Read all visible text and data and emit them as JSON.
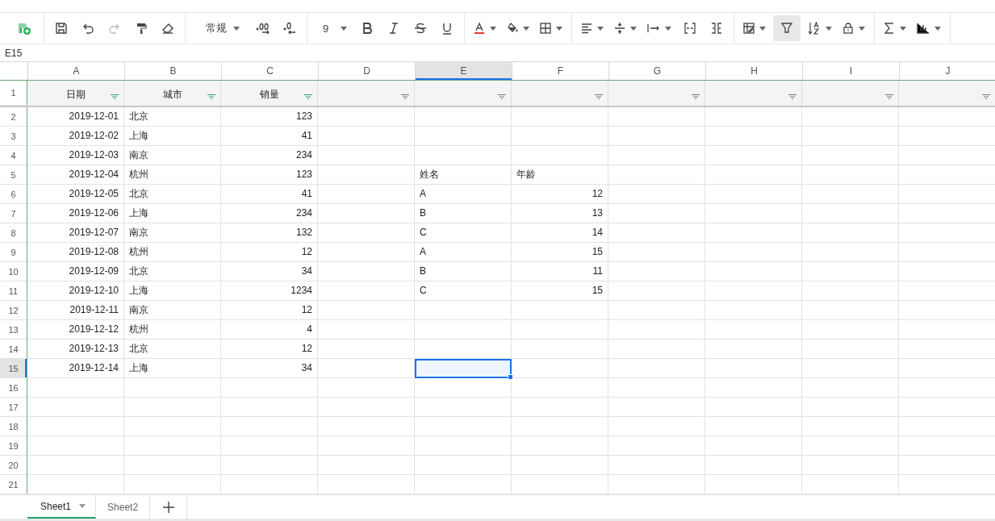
{
  "toolbar": {
    "number_format": "常规",
    "font_size": "9",
    "redo": {
      "disabled": true
    },
    "filter": {
      "selected": true
    }
  },
  "name_box": "E15",
  "columns": [
    {
      "label": "A",
      "selected": false
    },
    {
      "label": "B",
      "selected": false
    },
    {
      "label": "C",
      "selected": false
    },
    {
      "label": "D",
      "selected": false
    },
    {
      "label": "E",
      "selected": true
    },
    {
      "label": "F",
      "selected": false
    },
    {
      "label": "G",
      "selected": false
    },
    {
      "label": "H",
      "selected": false
    },
    {
      "label": "I",
      "selected": false
    },
    {
      "label": "J",
      "selected": false
    }
  ],
  "header_row": {
    "label": "1",
    "cells": [
      {
        "text": "日期",
        "active": true
      },
      {
        "text": "城市",
        "active": true
      },
      {
        "text": "销量",
        "active": true
      },
      {
        "active": false
      },
      {
        "active": false
      },
      {
        "active": false
      },
      {
        "active": false
      },
      {
        "active": false
      },
      {
        "active": false
      },
      {
        "active": false
      }
    ]
  },
  "rows": [
    {
      "label": "2",
      "selected": false,
      "cells": [
        {
          "text": "2019-12-01",
          "kind": "number"
        },
        {
          "text": "北京",
          "kind": "text"
        },
        {
          "text": "123",
          "kind": "number"
        }
      ]
    },
    {
      "label": "3",
      "selected": false,
      "cells": [
        {
          "text": "2019-12-02",
          "kind": "number"
        },
        {
          "text": "上海",
          "kind": "text"
        },
        {
          "text": "41",
          "kind": "number"
        }
      ]
    },
    {
      "label": "4",
      "selected": false,
      "cells": [
        {
          "text": "2019-12-03",
          "kind": "number"
        },
        {
          "text": "南京",
          "kind": "text"
        },
        {
          "text": "234",
          "kind": "number"
        }
      ]
    },
    {
      "label": "5",
      "selected": false,
      "cells": [
        {
          "text": "2019-12-04",
          "kind": "number"
        },
        {
          "text": "杭州",
          "kind": "text"
        },
        {
          "text": "123",
          "kind": "number"
        },
        null,
        {
          "text": "姓名",
          "kind": "text"
        },
        {
          "text": "年龄",
          "kind": "text"
        }
      ]
    },
    {
      "label": "6",
      "selected": false,
      "cells": [
        {
          "text": "2019-12-05",
          "kind": "number"
        },
        {
          "text": "北京",
          "kind": "text"
        },
        {
          "text": "41",
          "kind": "number"
        },
        null,
        {
          "text": "A",
          "kind": "text"
        },
        {
          "text": "12",
          "kind": "number"
        }
      ]
    },
    {
      "label": "7",
      "selected": false,
      "cells": [
        {
          "text": "2019-12-06",
          "kind": "number"
        },
        {
          "text": "上海",
          "kind": "text"
        },
        {
          "text": "234",
          "kind": "number"
        },
        null,
        {
          "text": "B",
          "kind": "text"
        },
        {
          "text": "13",
          "kind": "number"
        }
      ]
    },
    {
      "label": "8",
      "selected": false,
      "cells": [
        {
          "text": "2019-12-07",
          "kind": "number"
        },
        {
          "text": "南京",
          "kind": "text"
        },
        {
          "text": "132",
          "kind": "number"
        },
        null,
        {
          "text": "C",
          "kind": "text"
        },
        {
          "text": "14",
          "kind": "number"
        }
      ]
    },
    {
      "label": "9",
      "selected": false,
      "cells": [
        {
          "text": "2019-12-08",
          "kind": "number"
        },
        {
          "text": "杭州",
          "kind": "text"
        },
        {
          "text": "12",
          "kind": "number"
        },
        null,
        {
          "text": "A",
          "kind": "text"
        },
        {
          "text": "15",
          "kind": "number"
        }
      ]
    },
    {
      "label": "10",
      "selected": false,
      "cells": [
        {
          "text": "2019-12-09",
          "kind": "number"
        },
        {
          "text": "北京",
          "kind": "text"
        },
        {
          "text": "34",
          "kind": "number"
        },
        null,
        {
          "text": "B",
          "kind": "text"
        },
        {
          "text": "11",
          "kind": "number"
        }
      ]
    },
    {
      "label": "11",
      "selected": false,
      "cells": [
        {
          "text": "2019-12-10",
          "kind": "number"
        },
        {
          "text": "上海",
          "kind": "text"
        },
        {
          "text": "1234",
          "kind": "number"
        },
        null,
        {
          "text": "C",
          "kind": "text"
        },
        {
          "text": "15",
          "kind": "number"
        }
      ]
    },
    {
      "label": "12",
      "selected": false,
      "cells": [
        {
          "text": "2019-12-11",
          "kind": "number"
        },
        {
          "text": "南京",
          "kind": "text"
        },
        {
          "text": "12",
          "kind": "number"
        }
      ]
    },
    {
      "label": "13",
      "selected": false,
      "cells": [
        {
          "text": "2019-12-12",
          "kind": "number"
        },
        {
          "text": "杭州",
          "kind": "text"
        },
        {
          "text": "4",
          "kind": "number"
        }
      ]
    },
    {
      "label": "14",
      "selected": false,
      "cells": [
        {
          "text": "2019-12-13",
          "kind": "number"
        },
        {
          "text": "北京",
          "kind": "text"
        },
        {
          "text": "12",
          "kind": "number"
        }
      ]
    },
    {
      "label": "15",
      "selected": true,
      "cells": [
        {
          "text": "2019-12-14",
          "kind": "number"
        },
        {
          "text": "上海",
          "kind": "text"
        },
        {
          "text": "34",
          "kind": "number"
        }
      ]
    },
    {
      "label": "16",
      "selected": false
    },
    {
      "label": "17",
      "selected": false
    },
    {
      "label": "18",
      "selected": false
    },
    {
      "label": "19",
      "selected": false
    },
    {
      "label": "20",
      "selected": false
    },
    {
      "label": "21",
      "selected": false
    }
  ],
  "sheet_tabs": [
    {
      "label": "Sheet1",
      "selected": true
    },
    {
      "label": "Sheet2",
      "selected": false
    }
  ]
}
